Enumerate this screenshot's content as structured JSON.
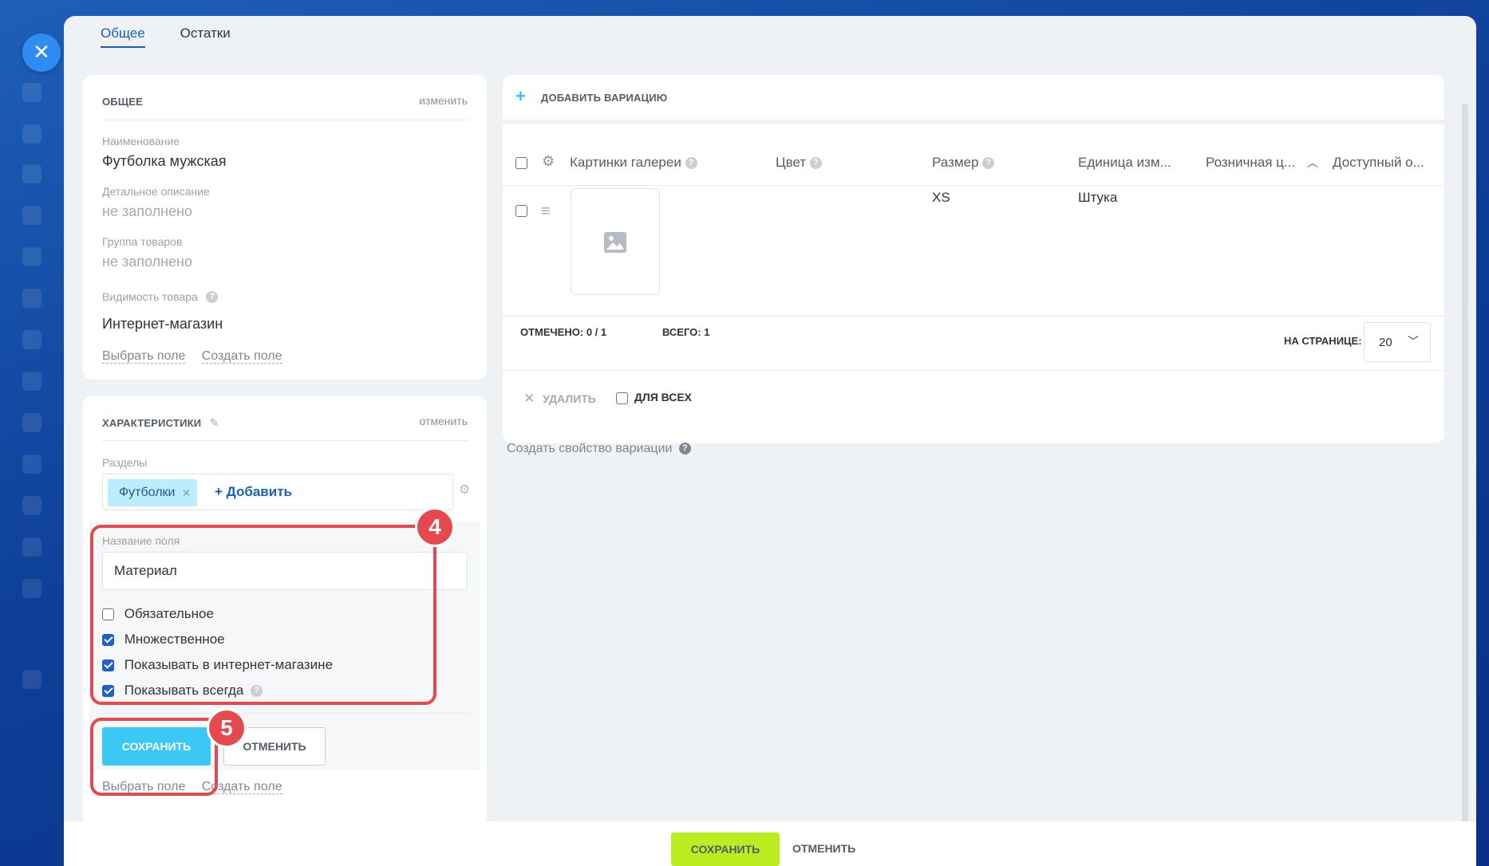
{
  "tabs": [
    "Общее",
    "Остатки"
  ],
  "general": {
    "title": "ОБЩЕЕ",
    "edit_link": "изменить",
    "fields": [
      {
        "label": "Наименование",
        "value": "Футболка мужская"
      },
      {
        "label": "Детальное описание",
        "value": "не заполнено"
      },
      {
        "label": "Группа товаров",
        "value": "не заполнено"
      }
    ],
    "visibility_label": "Видимость товара",
    "visibility_value": "Интернет-магазин",
    "select_field": "Выбрать поле",
    "create_field": "Создать поле"
  },
  "characteristics": {
    "title": "ХАРАКТЕРИСТИКИ",
    "cancel_link": "отменить",
    "sections_label": "Разделы",
    "section_tag": "Футболки",
    "add_label": "+ Добавить",
    "field_name_label": "Название поля",
    "field_name_value": "Материал",
    "options": [
      {
        "label": "Обязательное",
        "checked": false
      },
      {
        "label": "Множественное",
        "checked": true
      },
      {
        "label": "Показывать в интернет-магазине",
        "checked": true
      },
      {
        "label": "Показывать всегда",
        "checked": true
      }
    ],
    "save_label": "СОХРАНИТЬ",
    "cancel_label": "ОТМЕНИТЬ",
    "select_field": "Выбрать поле",
    "create_field": "Создать поле"
  },
  "annotations": {
    "badge_4": "4",
    "badge_5": "5",
    "color": "#e5484d"
  },
  "variations": {
    "add_label": "ДОБАВИТЬ ВАРИАЦИЮ",
    "columns": [
      "Картинки галереи",
      "Цвет",
      "Размер",
      "Единица изм...",
      "Розничная ц...",
      "Доступный о..."
    ],
    "rows": [
      {
        "size": "XS",
        "unit": "Штука"
      }
    ],
    "checked_label": "ОТМЕЧЕНО:",
    "checked_value": "0 / 1",
    "total_label": "ВСЕГО:",
    "total_value": "1",
    "per_page_label": "НА СТРАНИЦЕ:",
    "per_page_value": "20",
    "delete_label": "УДАЛИТЬ",
    "for_all_label": "ДЛЯ ВСЕХ",
    "create_property": "Создать свойство вариации"
  },
  "footer": {
    "save_label": "СОХРАНИТЬ",
    "cancel_label": "ОТМЕНИТЬ"
  },
  "colors": {
    "accent": "#3bc8f5",
    "primary_link": "#1b5fb7",
    "footer_save": "#bbed21"
  }
}
